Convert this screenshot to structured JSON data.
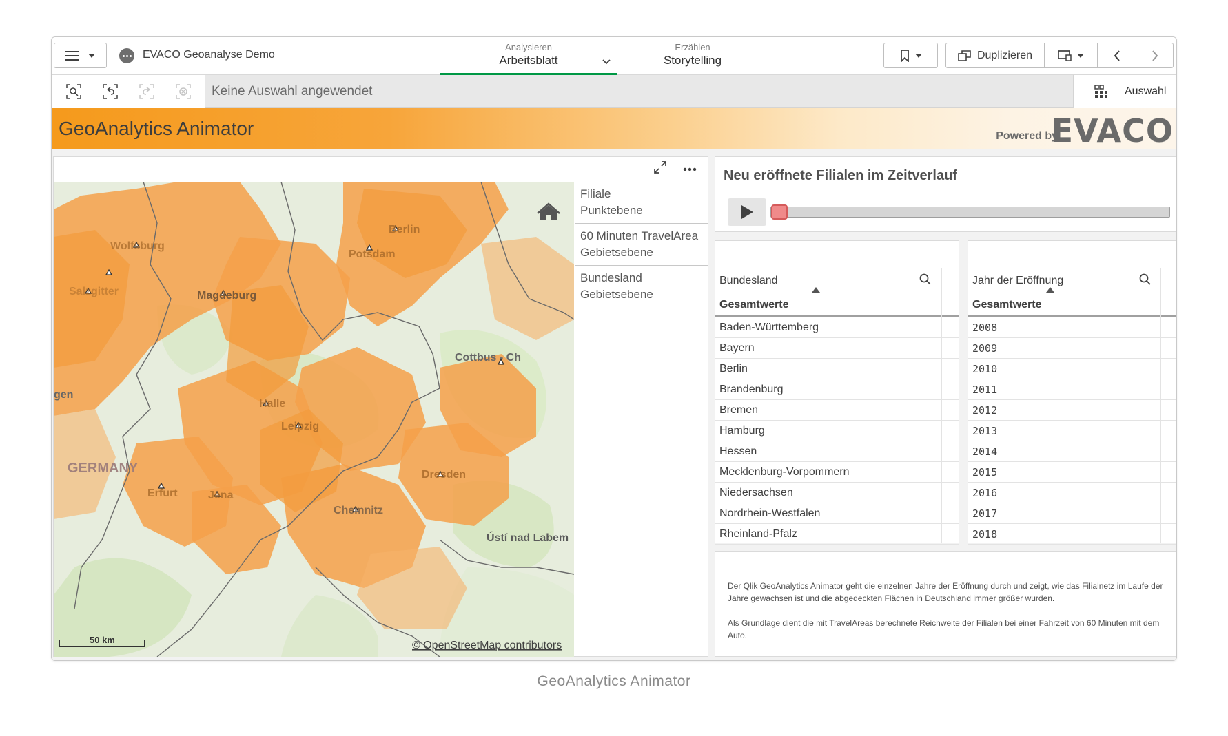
{
  "topbar": {
    "app_title": "EVACO Geoanalyse Demo",
    "tab_analyze_small": "Analysieren",
    "tab_analyze_big": "Arbeitsblatt",
    "tab_story_small": "Erzählen",
    "tab_story_big": "Storytelling",
    "duplicate_label": "Duplizieren"
  },
  "selection": {
    "status": "Keine Auswahl angewendet",
    "selections_label": "Auswahl"
  },
  "banner": {
    "title": "GeoAnalytics Animator",
    "powered_by": "Powered by",
    "brand": "EVACO"
  },
  "map": {
    "layers": [
      {
        "name": "Filiale",
        "type": "Punktebene"
      },
      {
        "name": "60 Minuten TravelArea",
        "type": "Gebietsebene"
      },
      {
        "name": "Bundesland",
        "type": "Gebietsebene"
      }
    ],
    "labels": {
      "wolfsburg": "Wolfsburg",
      "salzgitter": "Salzgitter",
      "magdeburg": "Magdeburg",
      "potsdam": "Potsdam",
      "berlin": "Berlin",
      "cottbus": "Cottbus - Ch",
      "halle": "Halle",
      "leipzig": "Leipzig",
      "gen": "gen",
      "germany": "GERMANY",
      "erfurt": "Erfurt",
      "jena": "Jena",
      "dresden": "Dresden",
      "chemnitz": "Chemnitz",
      "usti": "Ústí nad Labem"
    },
    "scale": "50 km",
    "attribution": "© OpenStreetMap contributors",
    "fill_color": "#f5a04a"
  },
  "animator": {
    "title": "Neu eröffnete Filialen im Zeitverlauf",
    "progress": 0.0
  },
  "filters": {
    "bundesland": {
      "header": "Bundesland",
      "total": "Gesamtwerte",
      "items": [
        "Baden-Württemberg",
        "Bayern",
        "Berlin",
        "Brandenburg",
        "Bremen",
        "Hamburg",
        "Hessen",
        "Mecklenburg-Vorpommern",
        "Niedersachsen",
        "Nordrhein-Westfalen",
        "Rheinland-Pfalz"
      ]
    },
    "jahr": {
      "header": "Jahr der Eröffnung",
      "total": "Gesamtwerte",
      "items": [
        "2008",
        "2009",
        "2010",
        "2011",
        "2012",
        "2013",
        "2014",
        "2015",
        "2016",
        "2017",
        "2018"
      ]
    }
  },
  "description": {
    "p1": "Der Qlik GeoAnalytics Animator geht die einzelnen Jahre der Eröffnung durch und zeigt, wie das Filialnetz im Laufe der Jahre gewachsen ist und die abgedeckten Flächen in Deutschland immer größer wurden.",
    "p2": "Als Grundlage dient die mit TravelAreas berechnete Reichweite der Filialen bei einer Fahrzeit von 60 Minuten mit dem Auto."
  },
  "caption": "GeoAnalytics Animator"
}
